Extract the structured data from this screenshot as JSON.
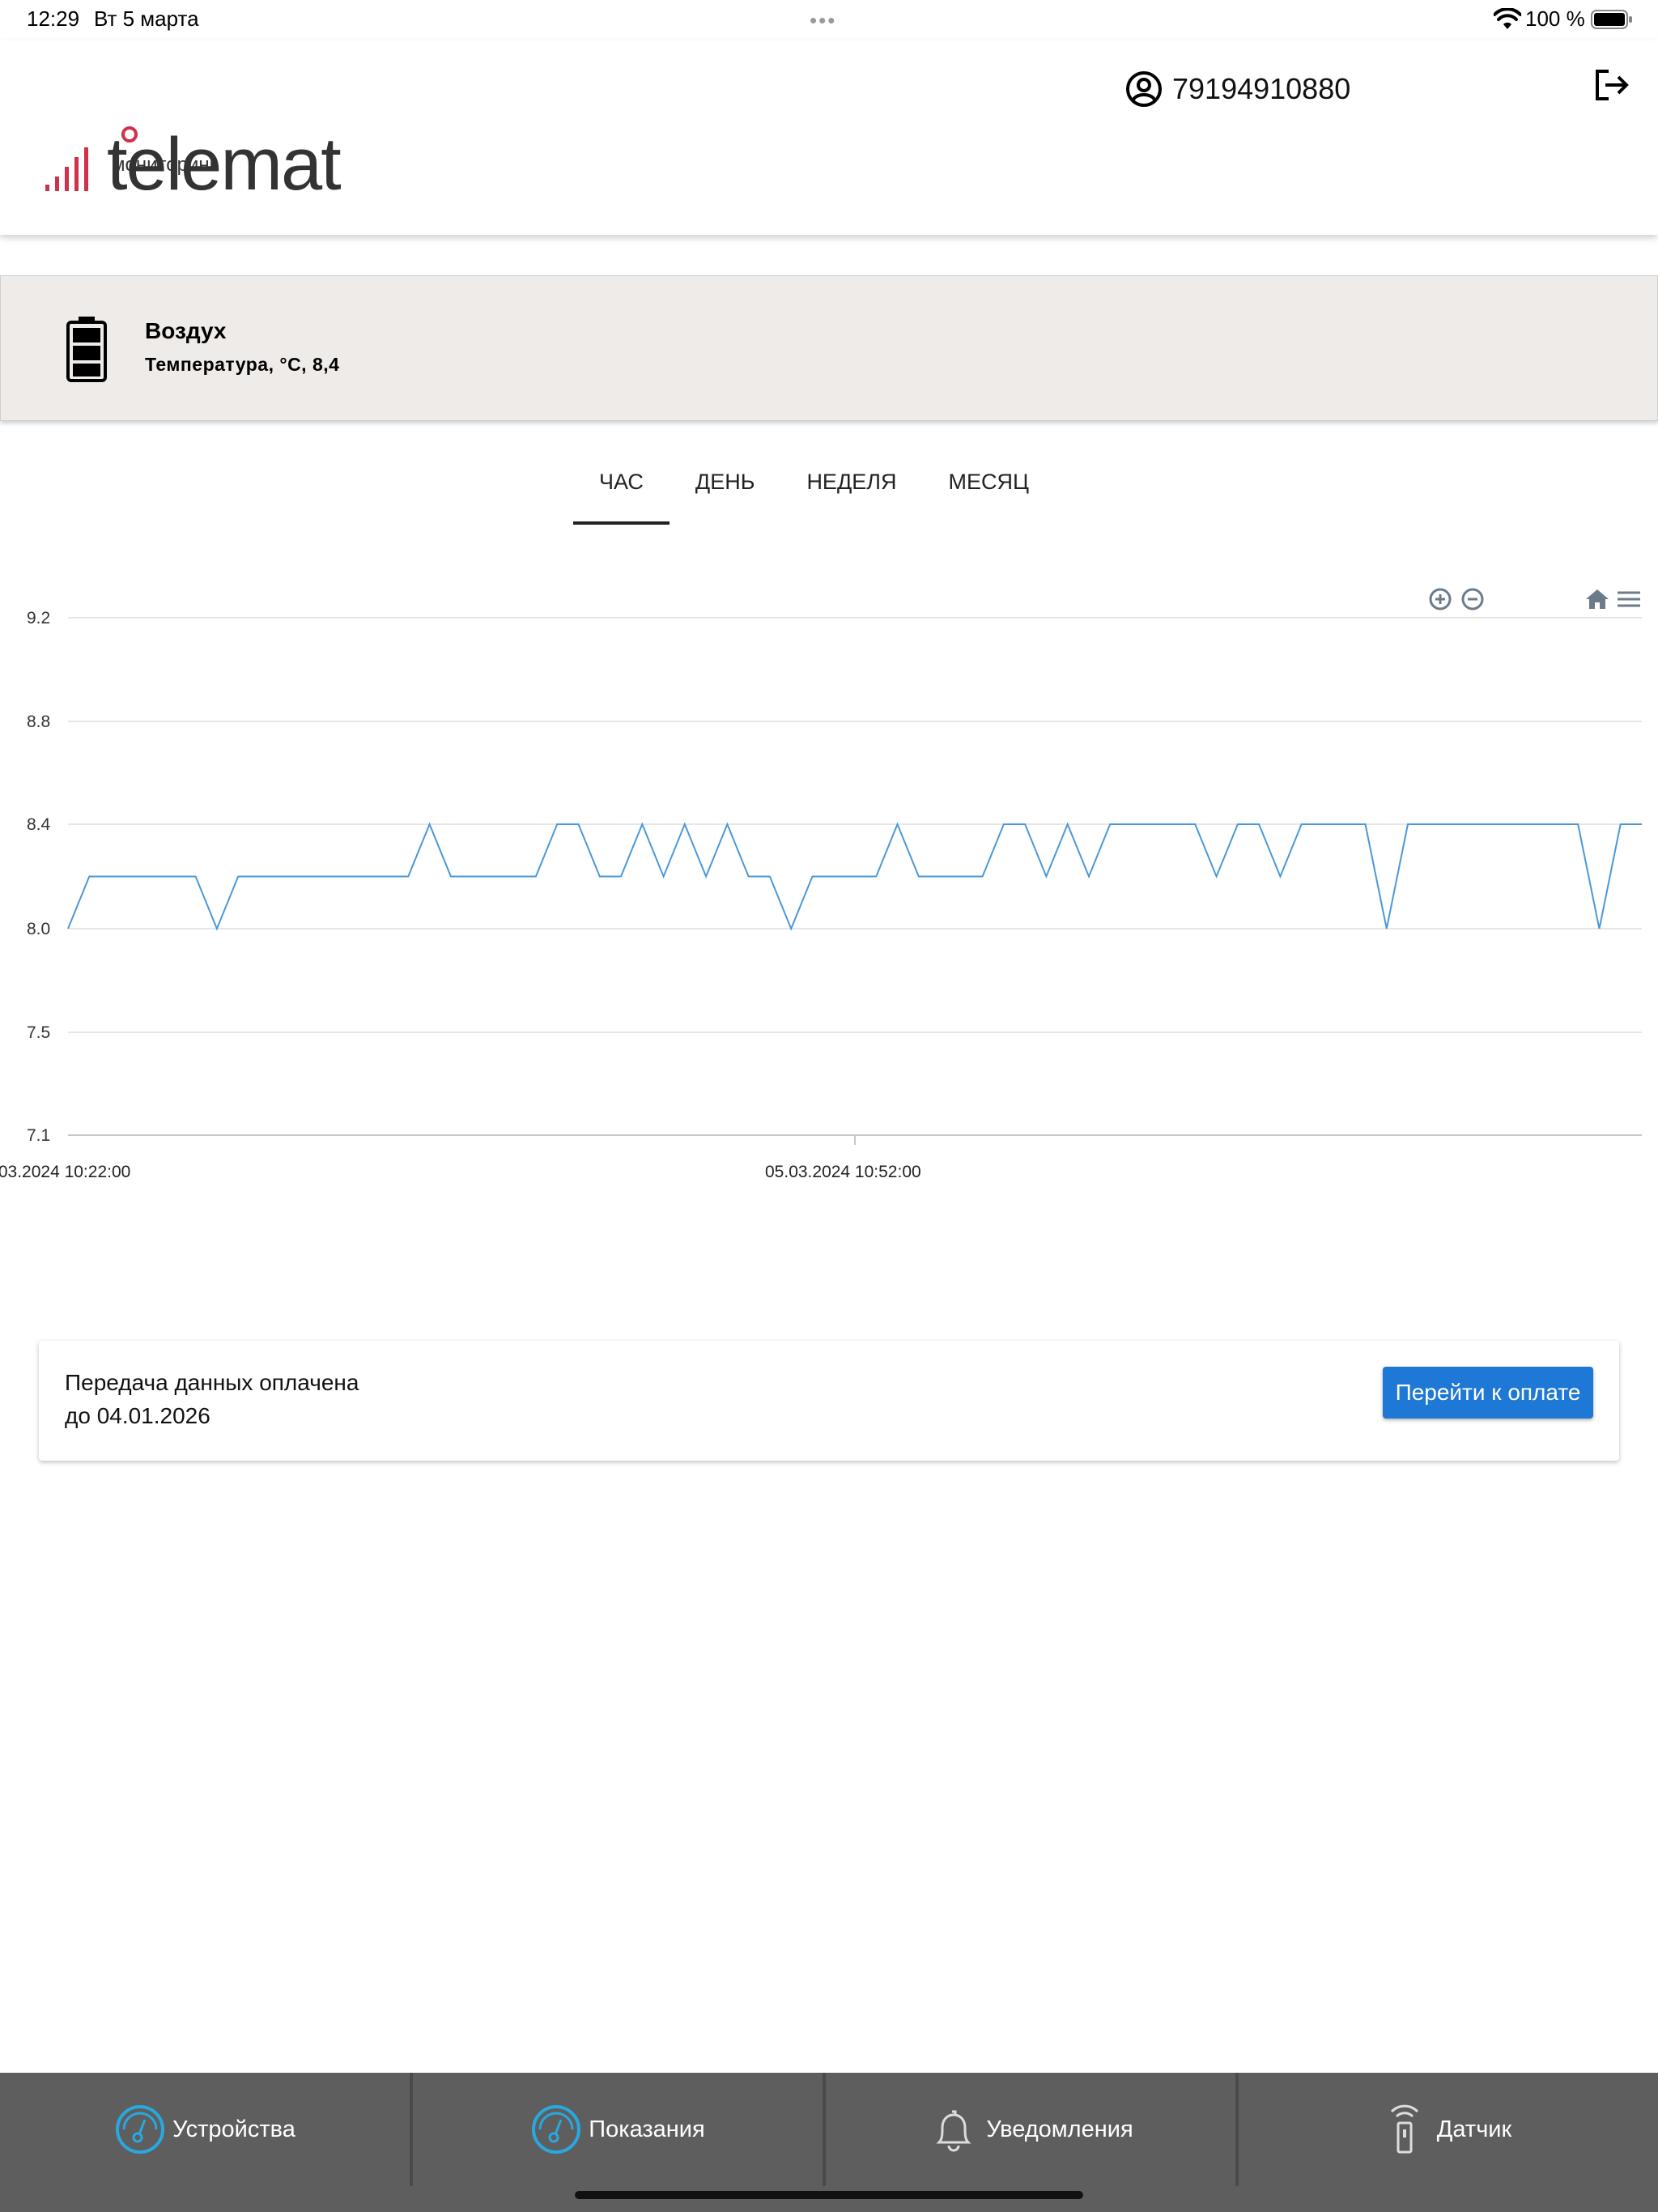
{
  "status_bar": {
    "time": "12:29",
    "date": "Вт 5 марта",
    "dots": "•••",
    "battery_percent": "100 %"
  },
  "header": {
    "logo_text": "telemat",
    "logo_subtitle": "мониторинг",
    "phone": "79194910880"
  },
  "device": {
    "name": "Воздух",
    "reading": "Температура, °C, 8,4"
  },
  "tabs": [
    {
      "label": "ЧАС",
      "active": true
    },
    {
      "label": "ДЕНЬ",
      "active": false
    },
    {
      "label": "НЕДЕЛЯ",
      "active": false
    },
    {
      "label": "МЕСЯЦ",
      "active": false
    }
  ],
  "chart_data": {
    "type": "line",
    "title": "",
    "xlabel": "",
    "ylabel": "",
    "y_ticks": [
      "9.2",
      "8.8",
      "8.4",
      "8.0",
      "7.5",
      "7.1"
    ],
    "x_ticks": [
      ".03.2024 10:22:00",
      "05.03.2024 10:52:00"
    ],
    "ylim": [
      7.1,
      9.2
    ],
    "line_color": "#4a98d8",
    "series": [
      {
        "values": [
          8.0,
          8.2,
          8.2,
          8.2,
          8.2,
          8.2,
          8.2,
          8.0,
          8.2,
          8.2,
          8.2,
          8.2,
          8.2,
          8.2,
          8.2,
          8.2,
          8.2,
          8.4,
          8.2,
          8.2,
          8.2,
          8.2,
          8.2,
          8.4,
          8.4,
          8.2,
          8.2,
          8.4,
          8.2,
          8.4,
          8.2,
          8.4,
          8.2,
          8.2,
          8.0,
          8.2,
          8.2,
          8.2,
          8.2,
          8.4,
          8.2,
          8.2,
          8.2,
          8.2,
          8.4,
          8.4,
          8.2,
          8.4,
          8.2,
          8.4,
          8.4,
          8.4,
          8.4,
          8.4,
          8.2,
          8.4,
          8.4,
          8.2,
          8.4,
          8.4,
          8.4,
          8.4,
          8.0,
          8.4,
          8.4,
          8.4,
          8.4,
          8.4,
          8.4,
          8.4,
          8.4,
          8.4,
          8.0,
          8.4,
          8.4
        ]
      }
    ]
  },
  "payment": {
    "line1": "Передача данных оплачена",
    "line2": "до 04.01.2026",
    "button": "Перейти к оплате"
  },
  "bottom_nav": [
    {
      "label": "Устройства",
      "icon": "gauge-icon",
      "color": "#29a8e0"
    },
    {
      "label": "Показания",
      "icon": "gauge-icon",
      "color": "#29a8e0"
    },
    {
      "label": "Уведомления",
      "icon": "bell-icon",
      "color": "#dddddd"
    },
    {
      "label": "Датчик",
      "icon": "sensor-icon",
      "color": "#dddddd"
    }
  ]
}
